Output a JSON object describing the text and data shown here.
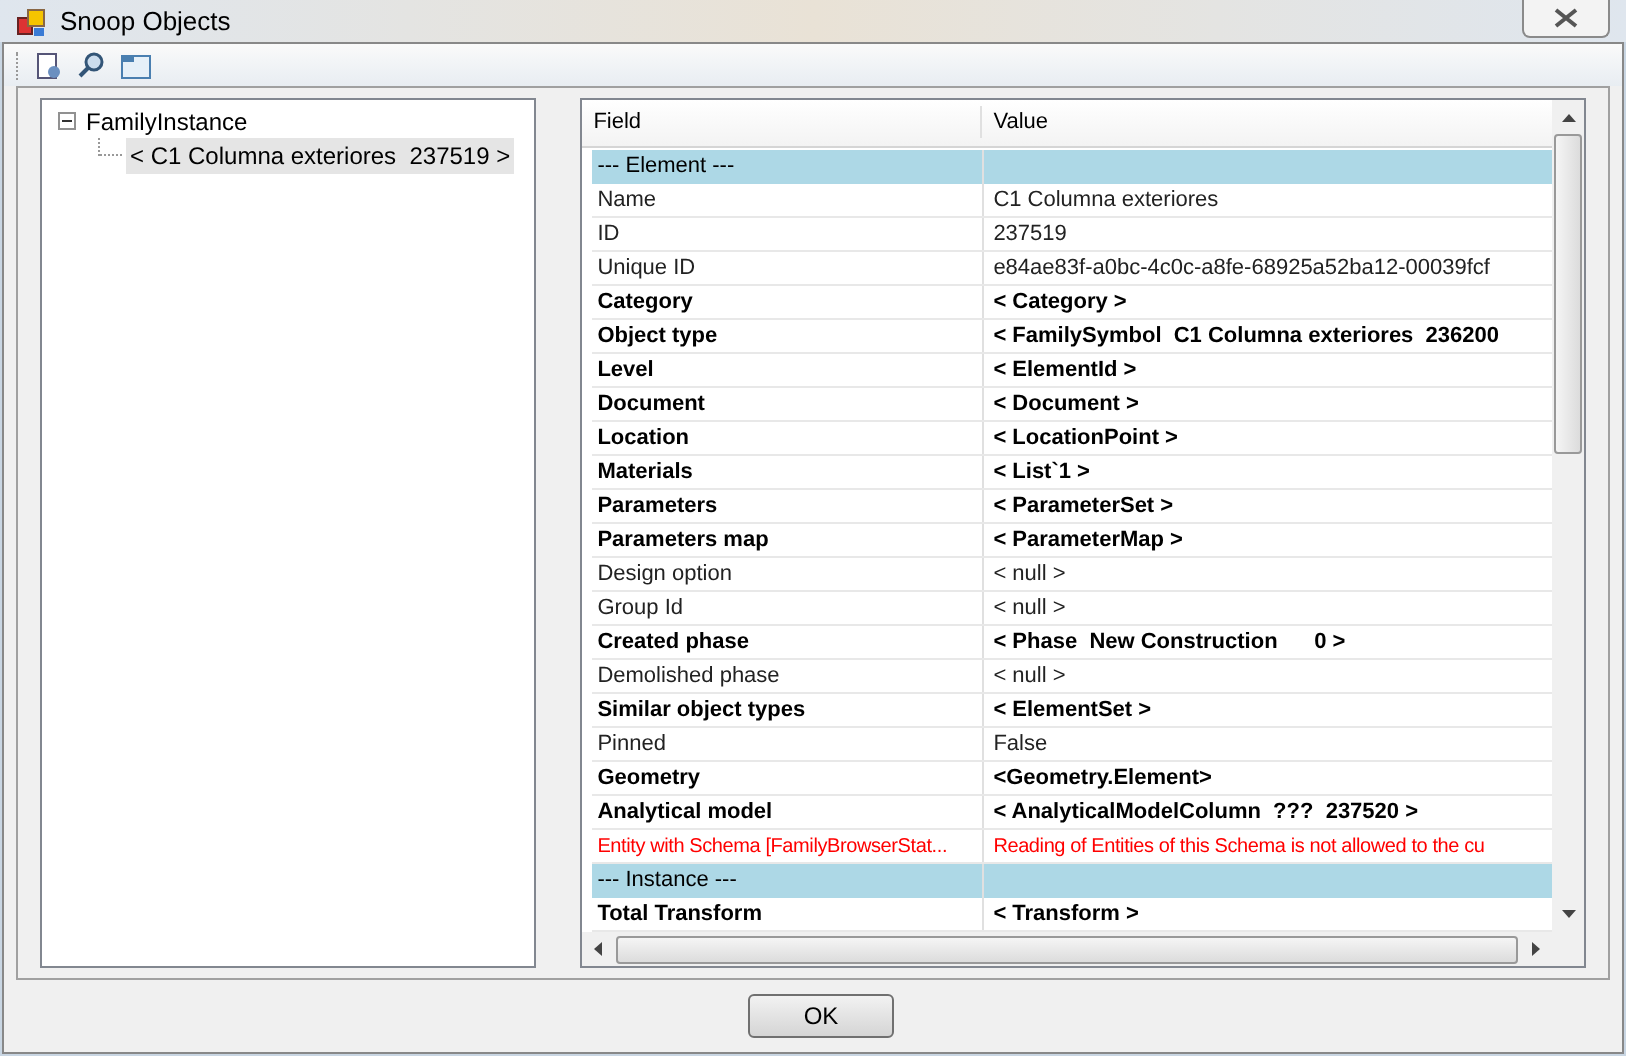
{
  "window": {
    "title": "Snoop Objects"
  },
  "tree": {
    "items": [
      {
        "label": "FamilyInstance",
        "expanded": true,
        "selected": false,
        "children": [
          {
            "label": "< C1 Columna exteriores  237519 >",
            "selected": true
          }
        ]
      }
    ]
  },
  "grid": {
    "columns": [
      "Field",
      "Value"
    ],
    "rows": [
      {
        "kind": "section",
        "field": "--- Element ---",
        "value": ""
      },
      {
        "kind": "normal",
        "field": "Name",
        "value": "C1 Columna exteriores"
      },
      {
        "kind": "normal",
        "field": "ID",
        "value": "237519"
      },
      {
        "kind": "normal",
        "field": "Unique ID",
        "value": "e84ae83f-a0bc-4c0c-a8fe-68925a52ba12-00039fcf"
      },
      {
        "kind": "bold",
        "field": "Category",
        "value": "< Category >"
      },
      {
        "kind": "bold",
        "field": "Object type",
        "value": "< FamilySymbol  C1 Columna exteriores  236200"
      },
      {
        "kind": "bold",
        "field": "Level",
        "value": "< ElementId >"
      },
      {
        "kind": "bold",
        "field": "Document",
        "value": "< Document >"
      },
      {
        "kind": "bold",
        "field": "Location",
        "value": "< LocationPoint >"
      },
      {
        "kind": "bold",
        "field": "Materials",
        "value": "< List`1 >"
      },
      {
        "kind": "bold",
        "field": "Parameters",
        "value": "< ParameterSet >"
      },
      {
        "kind": "bold",
        "field": "Parameters map",
        "value": "< ParameterMap >"
      },
      {
        "kind": "normal",
        "field": "Design option",
        "value": "< null >"
      },
      {
        "kind": "normal",
        "field": "Group Id",
        "value": "< null >"
      },
      {
        "kind": "bold",
        "field": "Created phase",
        "value": "< Phase  New Construction      0 >"
      },
      {
        "kind": "normal",
        "field": "Demolished phase",
        "value": "< null >"
      },
      {
        "kind": "bold",
        "field": "Similar object types",
        "value": "< ElementSet >"
      },
      {
        "kind": "normal",
        "field": "Pinned",
        "value": "False"
      },
      {
        "kind": "bold",
        "field": "Geometry",
        "value": "<Geometry.Element>"
      },
      {
        "kind": "bold",
        "field": "Analytical model",
        "value": "< AnalyticalModelColumn  ???  237520 >"
      },
      {
        "kind": "error",
        "field": "Entity with Schema [FamilyBrowserStat...",
        "value": "Reading of Entities of this Schema is not allowed to the cu"
      },
      {
        "kind": "section",
        "field": "--- Instance ---",
        "value": ""
      },
      {
        "kind": "bold",
        "field": "Total Transform",
        "value": "< Transform >"
      }
    ]
  },
  "buttons": [
    "OK"
  ]
}
